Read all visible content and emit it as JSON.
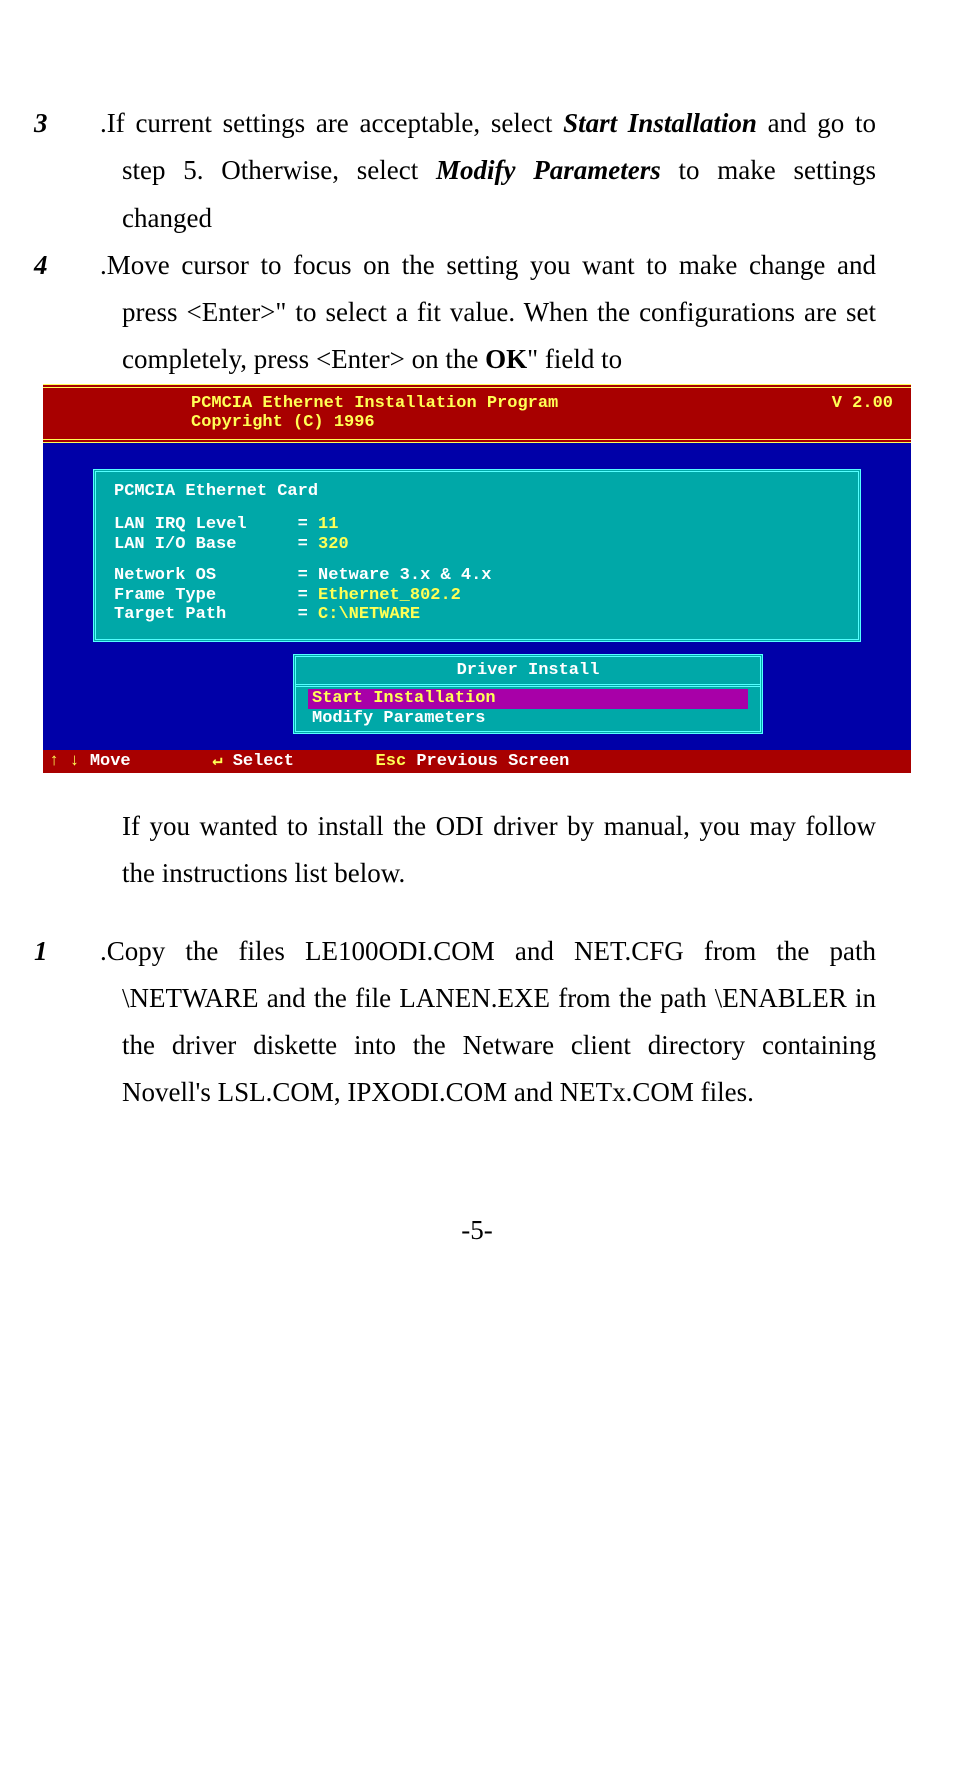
{
  "steps": {
    "s3": {
      "num": "3",
      "t1": ".If current settings are acceptable, select ",
      "b1": "Start Installation",
      "t2": " and go to step 5. Otherwise, select ",
      "b2": "Modify Parameters",
      "t3": " to make settings changed"
    },
    "s4": {
      "num": "4",
      "t1": ".Move cursor to focus on the setting you want to make change and press <Enter>\" to select a fit value. When the configurations are set completely, press <Enter> on the ",
      "b1": "OK",
      "t2": "\" field to"
    }
  },
  "term": {
    "title": "PCMCIA Ethernet Installation Program",
    "version": "V 2.00",
    "copyright": "Copyright (C) 1996",
    "panel_title": "PCMCIA Ethernet Card",
    "rows": [
      {
        "label": "LAN IRQ Level",
        "value": "11",
        "valcls": "val-y"
      },
      {
        "label": "LAN I/O Base",
        "value": "320",
        "valcls": "val-y"
      }
    ],
    "rows2": [
      {
        "label": "Network OS",
        "value": "Netware 3.x & 4.x",
        "valcls": "val-w"
      },
      {
        "label": "Frame Type",
        "value": "Ethernet_802.2",
        "valcls": "val-y"
      },
      {
        "label": "Target Path",
        "value": "C:\\NETWARE",
        "valcls": "val-y"
      }
    ],
    "driver_title": "Driver Install",
    "driver_items": [
      {
        "label": "Start Installation",
        "selected": true
      },
      {
        "label": "Modify Parameters",
        "selected": false
      }
    ],
    "footer": {
      "move": "Move",
      "select": "Select",
      "esc": "Esc",
      "prev": "Previous Screen"
    }
  },
  "after": {
    "p1": "If you wanted to install the ODI driver by manual, you may follow the instructions list below.",
    "s1": {
      "num": "1",
      "text": ".Copy the files LE100ODI.COM and NET.CFG from the path \\NETWARE and the file LANEN.EXE from the path \\ENABLER in the driver diskette into the Netware client directory containing Novell's LSL.COM, IPXODI.COM and NETx.COM files."
    }
  },
  "page_number": "-5-"
}
